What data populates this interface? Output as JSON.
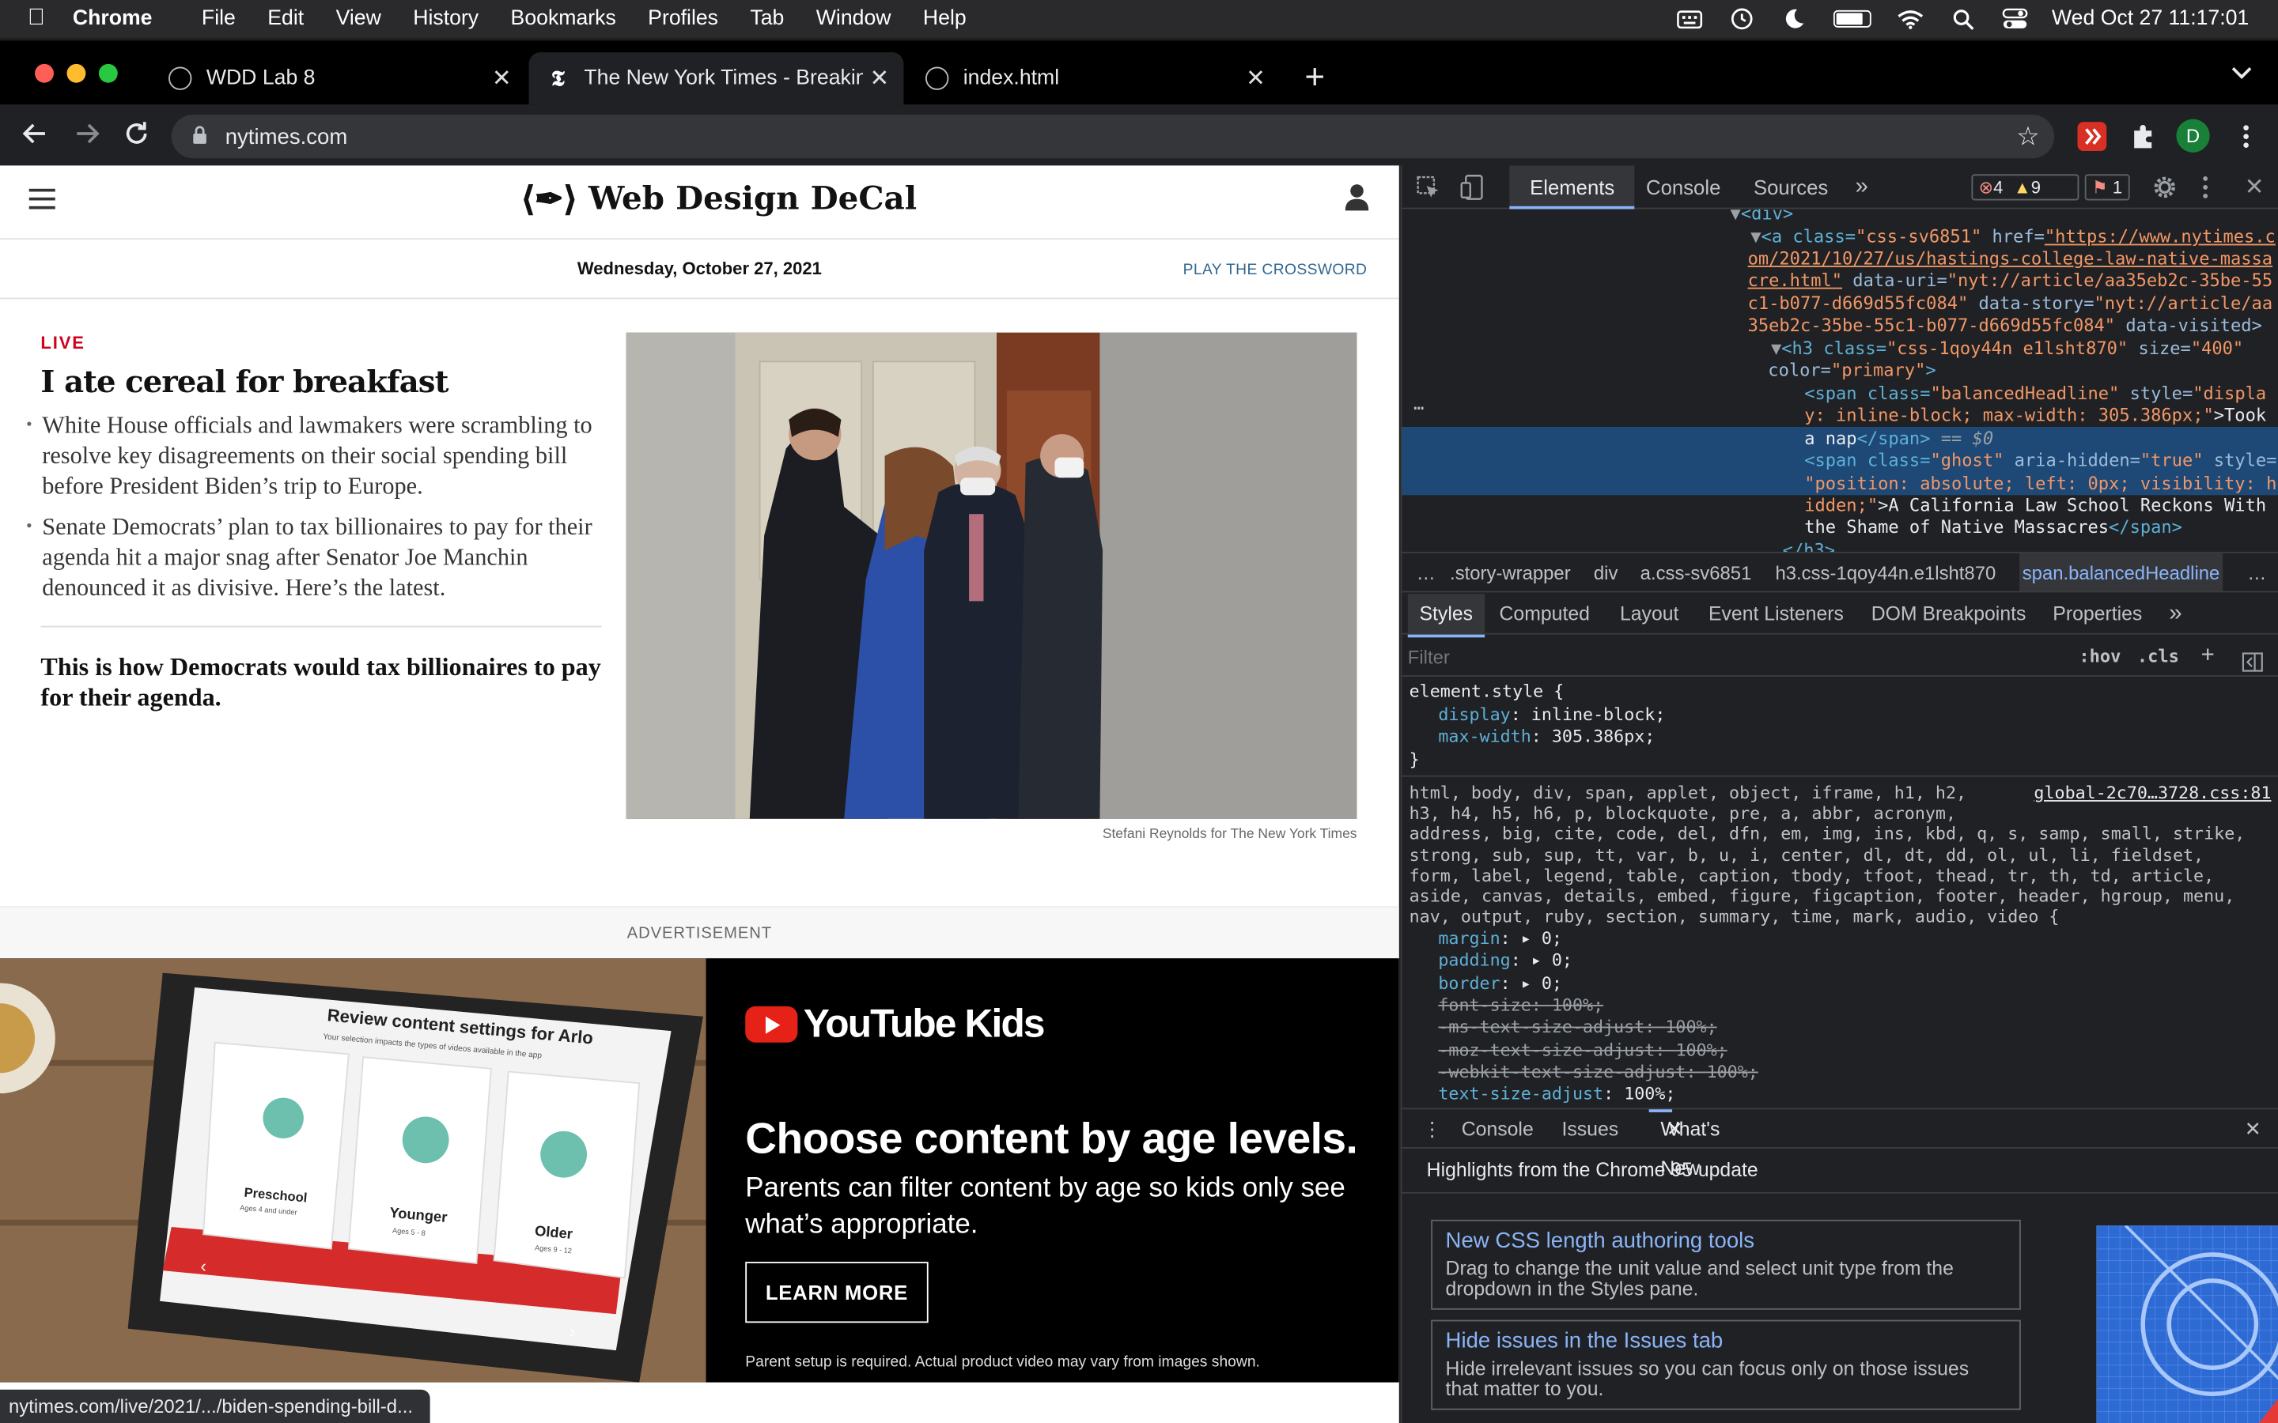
{
  "menubar": {
    "app": "Chrome",
    "items": [
      "File",
      "Edit",
      "View",
      "History",
      "Bookmarks",
      "Profiles",
      "Tab",
      "Window",
      "Help"
    ],
    "clock": "Wed Oct 27  11:17:01"
  },
  "tabs": [
    {
      "title": "WDD Lab 8"
    },
    {
      "title": "The New York Times - Breaking"
    },
    {
      "title": "index.html"
    }
  ],
  "toolbar": {
    "url": "nytimes.com",
    "profile_initial": "D"
  },
  "page": {
    "brand": "Web Design DeCal",
    "date": "Wednesday, October 27, 2021",
    "crossword": "PLAY THE CROSSWORD",
    "live_label": "LIVE",
    "headline": "I ate cereal for breakfast",
    "bullets": [
      "White House officials and lawmakers were scrambling to resolve key disagreements on their social spending bill before President Biden’s trip to Europe.",
      "Senate Democrats’ plan to tax billionaires to pay for their agenda hit a major snag after Senator Joe Manchin denounced it as divisive. Here’s the latest."
    ],
    "sub_headline": "This is how Democrats would tax billionaires to pay for their agenda.",
    "photo_credit": "Stefani Reynolds for The New York Times",
    "ad_label": "ADVERTISEMENT",
    "ad": {
      "brand": "YouTube Kids",
      "title": "Choose content by age levels.",
      "subtitle": "Parents can filter content by age so kids only see what’s appropriate.",
      "button": "LEARN MORE",
      "fine_print": "Parent setup is required. Actual product video may vary from images shown.",
      "tablet_title": "Review content settings for Arlo",
      "tablet_subtitle": "Your selection impacts the types of videos available in the app",
      "cards": [
        {
          "name": "Preschool",
          "age": "Ages 4 and under"
        },
        {
          "name": "Younger",
          "age": "Ages 5 - 8"
        },
        {
          "name": "Older",
          "age": "Ages 9 - 12"
        }
      ]
    },
    "status_url": "nytimes.com/live/2021/.../biden-spending-bill-d..."
  },
  "devtools": {
    "tabs": [
      "Elements",
      "Console",
      "Sources"
    ],
    "errors": "4",
    "warnings": "9",
    "issues": "1",
    "dom_lines": {
      "l0": "<div>",
      "l1a": "<a class=",
      "l1b": "\"css-sv6851\"",
      "l1c": " href=",
      "l1d": "\"https://www.nytimes.c",
      "l2": "om/2021/10/27/us/hastings-college-law-native-massa",
      "l3a": "cre.html\"",
      "l3b": " data-uri=",
      "l3c": "\"nyt://article/aa35eb2c-35be-55",
      "l4a": "c1-b077-d669d55fc084\"",
      "l4b": " data-story=",
      "l4c": "\"nyt://article/aa",
      "l5a": "35eb2c-35be-55c1-b077-d669d55fc084\"",
      "l5b": " data-visited>",
      "l6a": "<h3 class=",
      "l6b": "\"css-1qoy44n e1lsht870\"",
      "l6c": " size=",
      "l6d": "\"400\"",
      "l7a": "color=",
      "l7b": "\"primary\"",
      "l7c": ">",
      "l8a": "<span class=",
      "l8b": "\"balancedHeadline\"",
      "l8c": " style=",
      "l8d": "\"displa",
      "l9": "y: inline-block; max-width: 305.386px;\"",
      "l9b": ">Took",
      "l10a": "a nap",
      "l10b": "</span>",
      "l10c": " == $0",
      "l11a": "<span class=",
      "l11b": "\"ghost\"",
      "l11c": " aria-hidden=",
      "l11d": "\"true\"",
      "l11e": " style=",
      "l12": "\"position: absolute; left: 0px; visibility: h",
      "l13a": "idden;\"",
      "l13b": ">A California Law School Reckons With",
      "l14a": "the Shame of Native Massacres",
      "l14b": "</span>",
      "l15": "</h3>"
    },
    "breadcrumbs": [
      ".story-wrapper",
      "div",
      "a.css-sv6851",
      "h3.css-1qoy44n.e1lsht870",
      "span.balancedHeadline"
    ],
    "style_tabs": [
      "Styles",
      "Computed",
      "Layout",
      "Event Listeners",
      "DOM Breakpoints",
      "Properties"
    ],
    "filter_placeholder": "Filter",
    "hov": ":hov",
    "cls": ".cls",
    "element_style": {
      "selector": "element.style {",
      "rules": [
        {
          "prop": "display",
          "value": "inline-block;"
        },
        {
          "prop": "max-width",
          "value": "305.386px;"
        }
      ],
      "close": "}"
    },
    "rule_source": "global-2c70…3728.css:81",
    "selector_lines": [
      "html, body, div, span, applet, object, iframe, h1, h2,",
      "h3, h4, h5, h6, p, blockquote, pre, a, abbr, acronym,",
      "address, big, cite, code, del, dfn, em, img, ins, kbd, q, s, samp, small, strike,",
      "strong, sub, sup, tt, var, b, u, i, center, dl, dt, dd, ol, ul, li, fieldset,",
      "form, label, legend, table, caption, tbody, tfoot, thead, tr, th, td, article,",
      "aside, canvas, details, embed, figure, figcaption, footer, header, hgroup, menu,",
      "nav, output, ruby, section, summary, time, mark, audio, video {"
    ],
    "reset_rules": [
      {
        "prop": "margin",
        "value": "0;",
        "strike": false,
        "arrow": true
      },
      {
        "prop": "padding",
        "value": "0;",
        "strike": false,
        "arrow": true
      },
      {
        "prop": "border",
        "value": "0;",
        "strike": false,
        "arrow": true
      },
      {
        "prop": "font-size",
        "value": "100%;",
        "strike": true,
        "arrow": false
      },
      {
        "prop": "-ms-text-size-adjust",
        "value": "100%;",
        "strike": true,
        "arrow": false
      },
      {
        "prop": "-moz-text-size-adjust",
        "value": "100%;",
        "strike": true,
        "arrow": false
      },
      {
        "prop": "-webkit-text-size-adjust",
        "value": "100%;",
        "strike": true,
        "arrow": false
      },
      {
        "prop": "text-size-adjust",
        "value": "100%;",
        "strike": false,
        "arrow": false
      }
    ],
    "drawer_tabs": [
      "Console",
      "Issues",
      "What's New"
    ],
    "whats_new_heading": "Highlights from the Chrome 95 update",
    "cards": [
      {
        "title": "New CSS length authoring tools",
        "desc": "Drag to change the unit value and select unit type from the dropdown in the Styles pane."
      },
      {
        "title": "Hide issues in the Issues tab",
        "desc": "Hide irrelevant issues so you can focus only on those issues that matter to you."
      }
    ]
  }
}
